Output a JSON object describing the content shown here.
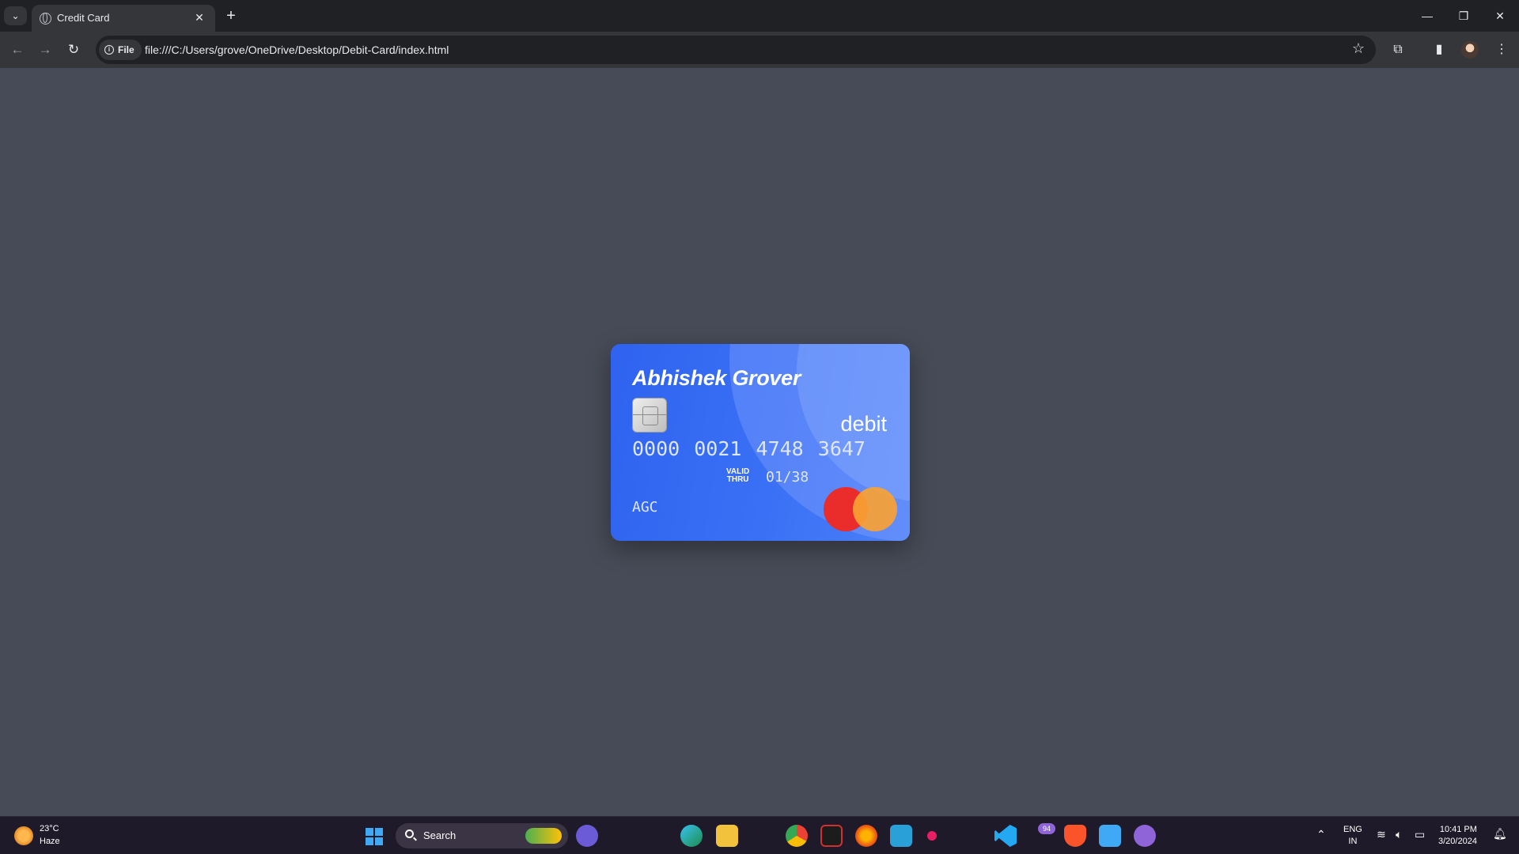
{
  "browser": {
    "tab_title": "Credit Card",
    "tab_close": "✕",
    "new_tab": "+",
    "site_chip": "File",
    "url": "file:///C:/Users/grove/OneDrive/Desktop/Debit-Card/index.html",
    "window_controls": {
      "minimize": "—",
      "restore": "❐",
      "close": "✕"
    }
  },
  "card": {
    "holder_name": "Abhishek Grover",
    "type": "debit",
    "number": "0000 0021 4748 3647",
    "valid_label_line1": "VALID",
    "valid_label_line2": "THRU",
    "valid_thru": "01/38",
    "initials": "AGC",
    "network": "mastercard",
    "colors": {
      "card_base": "#2f63f0",
      "mc_red": "#ea2c2a",
      "mc_orange": "#f9a233"
    }
  },
  "taskbar": {
    "weather_temp": "23°C",
    "weather_desc": "Haze",
    "search_label": "Search",
    "notification_count": "94",
    "lang_line1": "ENG",
    "lang_line2": "IN",
    "time": "10:41 PM",
    "date": "3/20/2024"
  },
  "page_background": "#474b57"
}
